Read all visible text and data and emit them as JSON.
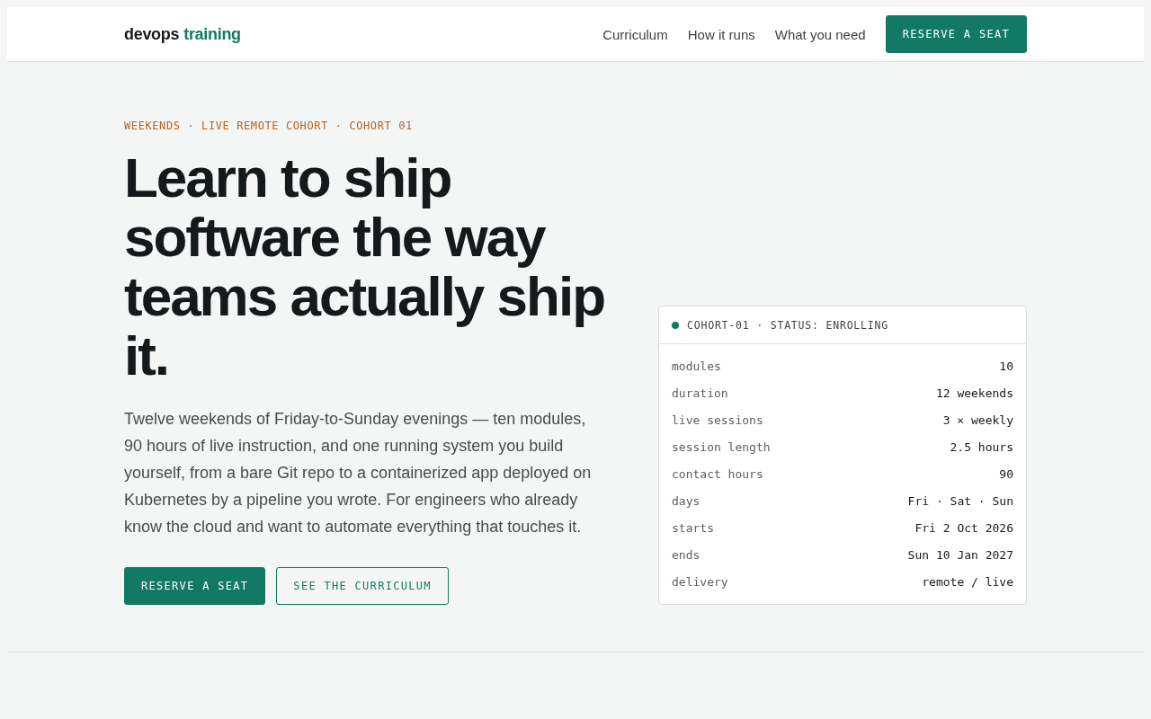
{
  "header": {
    "logo": {
      "first": "devops",
      "second": "training"
    },
    "nav": [
      {
        "label": "Curriculum"
      },
      {
        "label": "How it runs"
      },
      {
        "label": "What you need"
      }
    ],
    "cta": "RESERVE A SEAT"
  },
  "hero": {
    "eyebrow": "WEEKENDS · LIVE REMOTE COHORT · COHORT 01",
    "headline": "Learn to ship software the way teams actually ship it.",
    "lede": "Twelve weekends of Friday-to-Sunday evenings — ten modules, 90 hours of live instruction, and one running system you build yourself, from a bare Git repo to a containerized app deployed on Kubernetes by a pipeline you wrote. For engineers who already know the cloud and want to automate everything that touches it.",
    "buttons": [
      {
        "label": "RESERVE A SEAT",
        "kind": "primary"
      },
      {
        "label": "SEE THE CURRICULUM",
        "kind": "outline"
      }
    ]
  },
  "cohort_card": {
    "title": "COHORT-01 · STATUS: ENROLLING",
    "rows": [
      {
        "label": "modules",
        "value": "10"
      },
      {
        "label": "duration",
        "value": "12 weekends"
      },
      {
        "label": "live sessions",
        "value": "3 × weekly"
      },
      {
        "label": "session length",
        "value": "2.5 hours"
      },
      {
        "label": "contact hours",
        "value": "90"
      },
      {
        "label": "days",
        "value": "Fri · Sat · Sun"
      },
      {
        "label": "starts",
        "value": "Fri 2 Oct 2026"
      },
      {
        "label": "ends",
        "value": "Sun 10 Jan 2027"
      },
      {
        "label": "delivery",
        "value": "remote / live"
      }
    ]
  }
}
